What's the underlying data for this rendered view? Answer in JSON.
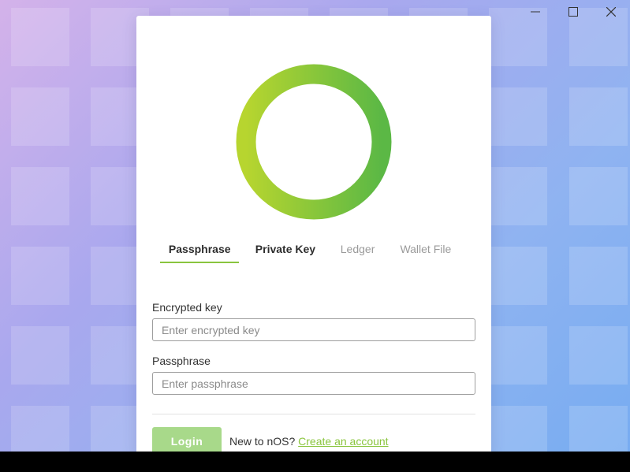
{
  "window_controls": {
    "minimize_icon": "minimize-icon",
    "maximize_icon": "maximize-icon",
    "close_icon": "close-icon"
  },
  "colors": {
    "accent": "#8ac53e",
    "logo_gradient_start": "#b7d52f",
    "logo_gradient_end": "#5bb845",
    "login_button": "#a8d98a"
  },
  "tabs": [
    {
      "label": "Passphrase",
      "state": "active"
    },
    {
      "label": "Private Key",
      "state": "bold"
    },
    {
      "label": "Ledger",
      "state": "inactive"
    },
    {
      "label": "Wallet File",
      "state": "inactive"
    }
  ],
  "form": {
    "encrypted_key": {
      "label": "Encrypted key",
      "placeholder": "Enter encrypted key",
      "value": ""
    },
    "passphrase": {
      "label": "Passphrase",
      "placeholder": "Enter passphrase",
      "value": ""
    }
  },
  "login_button": {
    "label": "Login"
  },
  "signup": {
    "prompt": "New to nOS?",
    "link": "Create an account"
  }
}
